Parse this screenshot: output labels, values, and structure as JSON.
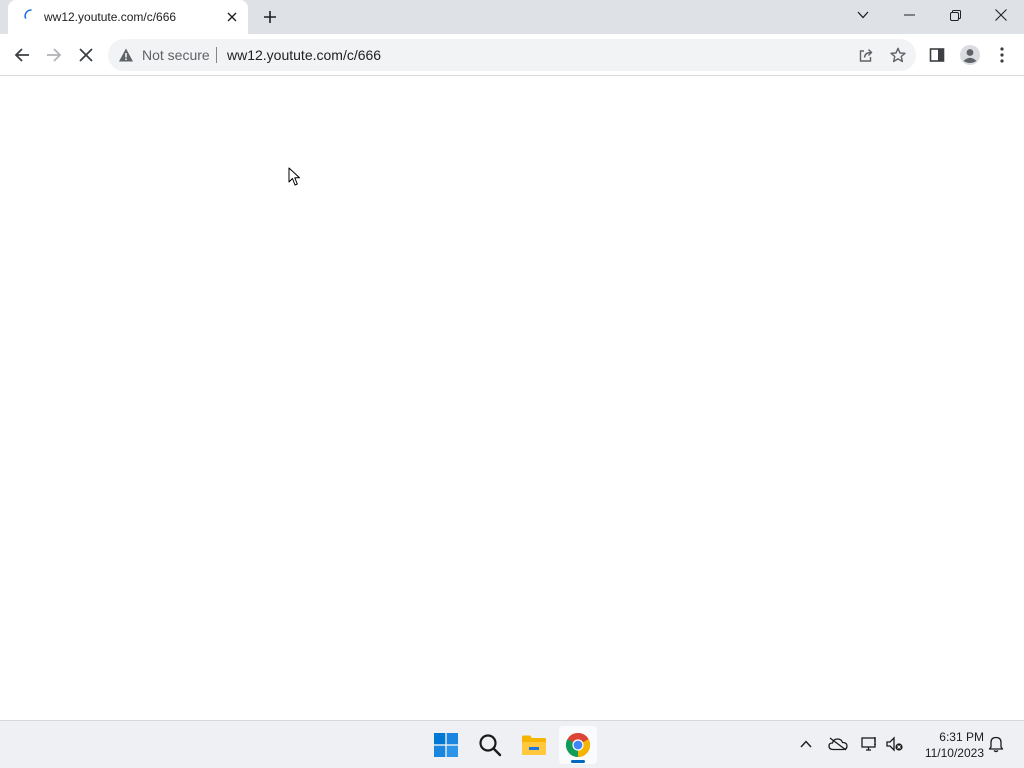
{
  "browser": {
    "tab": {
      "title": "ww12.youtute.com/c/666"
    },
    "address_bar": {
      "security_label": "Not secure",
      "url": "ww12.youtute.com/c/666"
    }
  },
  "taskbar": {
    "clock": {
      "time": "6:31 PM",
      "date": "11/10/2023"
    }
  },
  "colors": {
    "tab_strip": "#dee1e6",
    "omnibox": "#f1f3f4",
    "taskbar": "#eef0f3",
    "windows_blue": "#0078d4",
    "active_indicator": "#0067c0"
  },
  "icons": [
    "loading-spinner-icon",
    "close-icon",
    "plus-icon",
    "chevron-down-icon",
    "minimize-icon",
    "restore-icon",
    "back-arrow-icon",
    "forward-arrow-icon",
    "stop-icon",
    "warning-icon",
    "share-icon",
    "star-icon",
    "side-panel-icon",
    "profile-icon",
    "kebab-menu-icon",
    "windows-start-icon",
    "search-icon",
    "file-explorer-icon",
    "chrome-icon",
    "chevron-up-icon",
    "onedrive-icon",
    "network-icon",
    "volume-muted-icon",
    "bell-icon",
    "mouse-cursor-icon"
  ]
}
